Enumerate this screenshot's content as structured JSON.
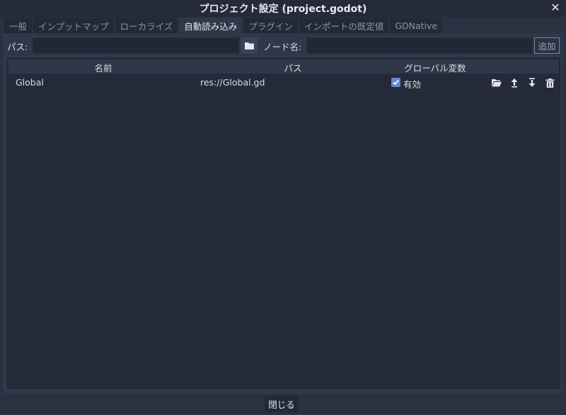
{
  "window": {
    "title": "プロジェクト設定 (project.godot)"
  },
  "tabs": [
    {
      "label": "一般",
      "active": false
    },
    {
      "label": "インプットマップ",
      "active": false
    },
    {
      "label": "ローカライズ",
      "active": false
    },
    {
      "label": "自動読み込み",
      "active": true
    },
    {
      "label": "プラグイン",
      "active": false
    },
    {
      "label": "インポートの既定値",
      "active": false
    },
    {
      "label": "GDNative",
      "active": false
    }
  ],
  "path_row": {
    "path_label": "パス:",
    "path_value": "",
    "node_name_label": "ノード名:",
    "node_name_value": "",
    "add_label": "追加"
  },
  "table": {
    "columns": [
      "名前",
      "パス",
      "グローバル変数"
    ],
    "rows": [
      {
        "name": "Global",
        "path": "res://Global.gd",
        "global_enabled": true,
        "global_label": "有効"
      }
    ]
  },
  "footer": {
    "close_label": "閉じる"
  },
  "icons": [
    "close-icon",
    "folder-icon",
    "open-folder-icon",
    "move-up-icon",
    "move-down-icon",
    "delete-icon",
    "checkmark-icon"
  ],
  "colors": {
    "accent": "#5b8bd6",
    "background": "#2a3140",
    "panel": "#2f3749"
  }
}
